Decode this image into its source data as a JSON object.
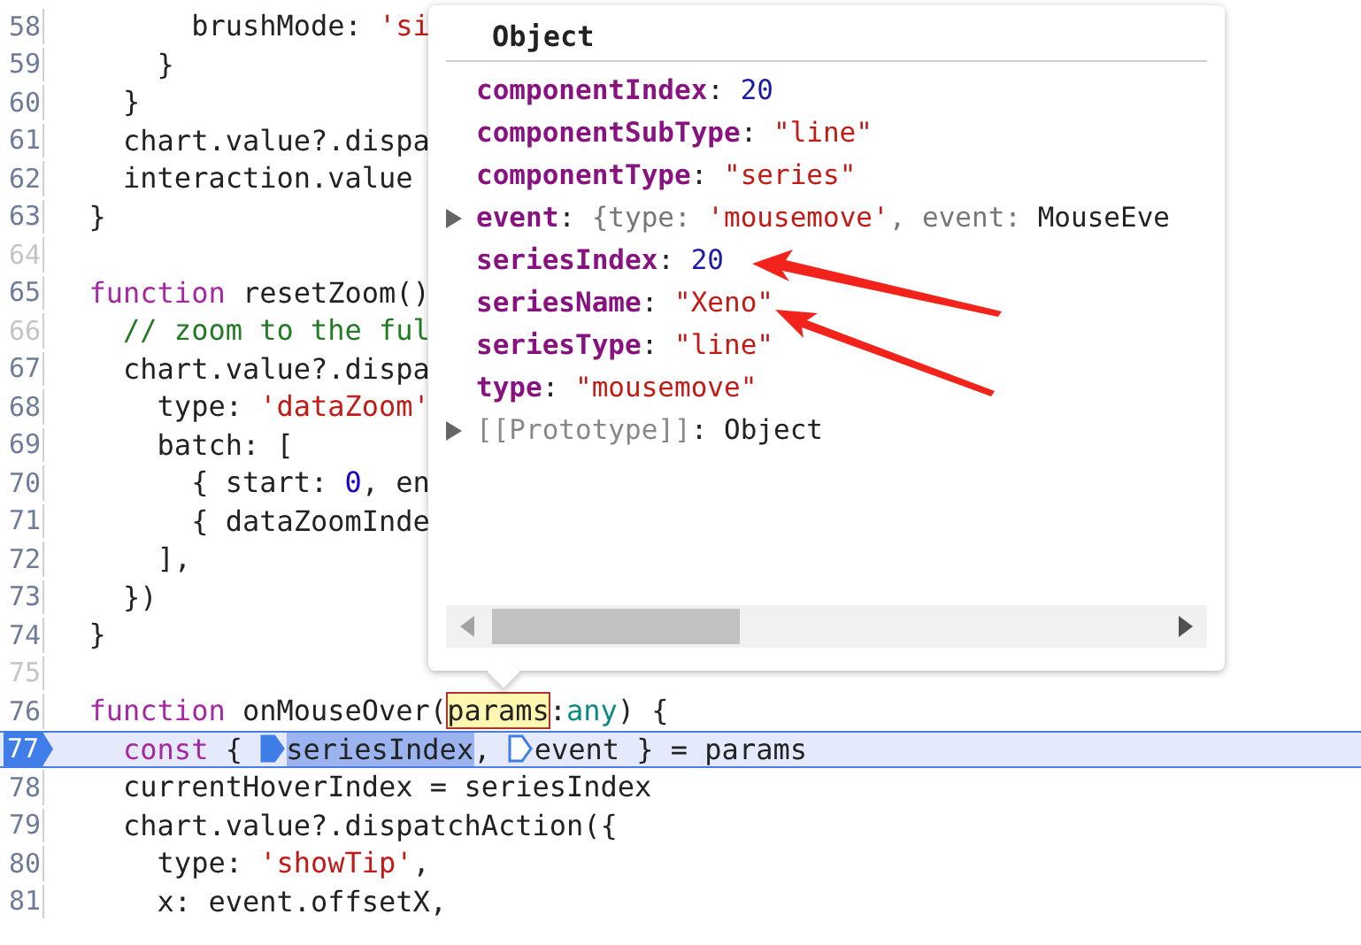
{
  "code_lines": [
    {
      "number": "58",
      "dimmed": false,
      "current": false,
      "tokens": [
        {
          "kind": "plain",
          "text": "        brushMode: "
        },
        {
          "kind": "string",
          "text": "'si"
        }
      ]
    },
    {
      "number": "59",
      "dimmed": false,
      "current": false,
      "tokens": [
        {
          "kind": "plain",
          "text": "      }"
        }
      ]
    },
    {
      "number": "60",
      "dimmed": false,
      "current": false,
      "tokens": [
        {
          "kind": "plain",
          "text": "    }"
        }
      ]
    },
    {
      "number": "61",
      "dimmed": false,
      "current": false,
      "tokens": [
        {
          "kind": "plain",
          "text": "    chart.value?.dispa"
        }
      ]
    },
    {
      "number": "62",
      "dimmed": false,
      "current": false,
      "tokens": [
        {
          "kind": "plain",
          "text": "    interaction.value"
        }
      ]
    },
    {
      "number": "63",
      "dimmed": false,
      "current": false,
      "tokens": [
        {
          "kind": "plain",
          "text": "  }"
        }
      ]
    },
    {
      "number": "64",
      "dimmed": true,
      "current": false
    },
    {
      "number": "65",
      "dimmed": false,
      "current": false,
      "tokens": [
        {
          "kind": "keyword",
          "text": "  function"
        },
        {
          "kind": "plain",
          "text": " resetZoom()"
        }
      ]
    },
    {
      "number": "66",
      "dimmed": true,
      "current": false,
      "tokens": [
        {
          "kind": "comment",
          "text": "    // zoom to the ful"
        }
      ]
    },
    {
      "number": "67",
      "dimmed": false,
      "current": false,
      "tokens": [
        {
          "kind": "plain",
          "text": "    chart.value?.dispa"
        }
      ]
    },
    {
      "number": "68",
      "dimmed": false,
      "current": false,
      "tokens": [
        {
          "kind": "plain",
          "text": "      type: "
        },
        {
          "kind": "string",
          "text": "'dataZoom'"
        }
      ]
    },
    {
      "number": "69",
      "dimmed": false,
      "current": false,
      "tokens": [
        {
          "kind": "plain",
          "text": "      batch: ["
        }
      ]
    },
    {
      "number": "70",
      "dimmed": false,
      "current": false,
      "tokens": [
        {
          "kind": "plain",
          "text": "        { start: "
        },
        {
          "kind": "number",
          "text": "0"
        },
        {
          "kind": "plain",
          "text": ", en"
        }
      ]
    },
    {
      "number": "71",
      "dimmed": false,
      "current": false,
      "tokens": [
        {
          "kind": "plain",
          "text": "        { dataZoomInde"
        }
      ]
    },
    {
      "number": "72",
      "dimmed": false,
      "current": false,
      "tokens": [
        {
          "kind": "plain",
          "text": "      ],"
        }
      ]
    },
    {
      "number": "73",
      "dimmed": false,
      "current": false,
      "tokens": [
        {
          "kind": "plain",
          "text": "    })"
        }
      ]
    },
    {
      "number": "74",
      "dimmed": false,
      "current": false,
      "tokens": [
        {
          "kind": "plain",
          "text": "  }"
        }
      ]
    },
    {
      "number": "75",
      "dimmed": true,
      "current": false
    },
    {
      "number": "76",
      "dimmed": false,
      "current": false,
      "tokens": [
        {
          "kind": "keyword",
          "text": "  function"
        },
        {
          "kind": "plain",
          "text": " onMouseOver("
        },
        {
          "kind": "match",
          "text": "params"
        },
        {
          "kind": "plain",
          "text": ":"
        },
        {
          "kind": "type",
          "text": "any"
        },
        {
          "kind": "plain",
          "text": ") {"
        }
      ]
    },
    {
      "number": "77",
      "dimmed": false,
      "current": true,
      "tokens": [
        {
          "kind": "keyword",
          "text": "    const"
        },
        {
          "kind": "plain",
          "text": " { "
        },
        {
          "kind": "marker",
          "active": true
        },
        {
          "kind": "selection",
          "text": "seriesIndex"
        },
        {
          "kind": "plain",
          "text": ", "
        },
        {
          "kind": "marker",
          "active": false
        },
        {
          "kind": "plain",
          "text": "event } = params"
        }
      ]
    },
    {
      "number": "78",
      "dimmed": false,
      "current": false,
      "tokens": [
        {
          "kind": "plain",
          "text": "    currentHoverIndex = seriesIndex"
        }
      ]
    },
    {
      "number": "79",
      "dimmed": false,
      "current": false,
      "tokens": [
        {
          "kind": "plain",
          "text": "    chart.value?.dispatchAction({"
        }
      ]
    },
    {
      "number": "80",
      "dimmed": false,
      "current": false,
      "tokens": [
        {
          "kind": "plain",
          "text": "      type: "
        },
        {
          "kind": "string",
          "text": "'showTip'"
        },
        {
          "kind": "plain",
          "text": ","
        }
      ]
    },
    {
      "number": "81",
      "dimmed": false,
      "current": false,
      "tokens": [
        {
          "kind": "plain",
          "text": "      x: event.offsetX,"
        }
      ]
    }
  ],
  "popover": {
    "title": "Object",
    "properties": [
      {
        "key": "componentIndex",
        "internal": false,
        "expandable": false,
        "value": [
          {
            "kind": "plain",
            "text": ": "
          },
          {
            "kind": "number",
            "text": "20"
          }
        ]
      },
      {
        "key": "componentSubType",
        "internal": false,
        "expandable": false,
        "value": [
          {
            "kind": "plain",
            "text": ": "
          },
          {
            "kind": "string",
            "text": "\"line\""
          }
        ]
      },
      {
        "key": "componentType",
        "internal": false,
        "expandable": false,
        "value": [
          {
            "kind": "plain",
            "text": ": "
          },
          {
            "kind": "string",
            "text": "\"series\""
          }
        ]
      },
      {
        "key": "event",
        "internal": false,
        "expandable": true,
        "value": [
          {
            "kind": "plain",
            "text": ": "
          },
          {
            "kind": "punct",
            "text": "{type: "
          },
          {
            "kind": "string",
            "text": "'mousemove'"
          },
          {
            "kind": "punct",
            "text": ", event: "
          },
          {
            "kind": "plain",
            "text": "MouseEve"
          }
        ]
      },
      {
        "key": "seriesIndex",
        "internal": false,
        "expandable": false,
        "value": [
          {
            "kind": "plain",
            "text": ": "
          },
          {
            "kind": "number",
            "text": "20"
          }
        ]
      },
      {
        "key": "seriesName",
        "internal": false,
        "expandable": false,
        "value": [
          {
            "kind": "plain",
            "text": ": "
          },
          {
            "kind": "string",
            "text": "\"Xeno\""
          }
        ]
      },
      {
        "key": "seriesType",
        "internal": false,
        "expandable": false,
        "value": [
          {
            "kind": "plain",
            "text": ": "
          },
          {
            "kind": "string",
            "text": "\"line\""
          }
        ]
      },
      {
        "key": "type",
        "internal": false,
        "expandable": false,
        "value": [
          {
            "kind": "plain",
            "text": ": "
          },
          {
            "kind": "string",
            "text": "\"mousemove\""
          }
        ]
      },
      {
        "key": "[[Prototype]]",
        "internal": true,
        "expandable": true,
        "value": [
          {
            "kind": "plain",
            "text": ": "
          },
          {
            "kind": "plain",
            "text": "Object"
          }
        ]
      }
    ]
  }
}
